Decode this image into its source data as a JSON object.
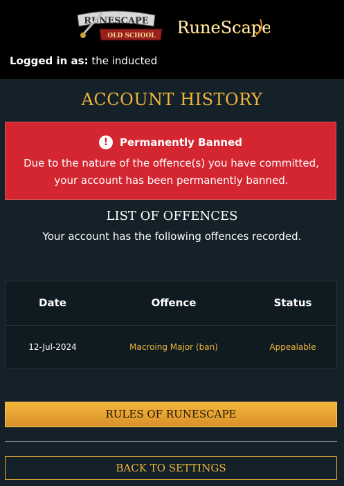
{
  "header": {
    "logged_in_label": "Logged in as:",
    "username": "the inducted",
    "logos": {
      "old_school": "osrs-logo",
      "runescape": "runescape-logo",
      "runescape_text": "RuneScape"
    }
  },
  "page_title": "ACCOUNT HISTORY",
  "ban_notice": {
    "icon": "alert-icon",
    "heading": "Permanently Banned",
    "message": "Due to the nature of the offence(s) you have committed, your account has been permanently banned."
  },
  "offences": {
    "title": "LIST OF OFFENCES",
    "subtitle": "Your account has the following offences recorded.",
    "columns": [
      "Date",
      "Offence",
      "Status"
    ],
    "rows": [
      {
        "date": "12-Jul-2024",
        "offence": "Macroing Major (ban)",
        "status": "Appealable"
      }
    ]
  },
  "buttons": {
    "rules": "RULES OF RUNESCAPE",
    "back": "BACK TO SETTINGS"
  },
  "colors": {
    "background": "#142129",
    "gold": "#f0b53a",
    "ban_red": "#d42630"
  }
}
